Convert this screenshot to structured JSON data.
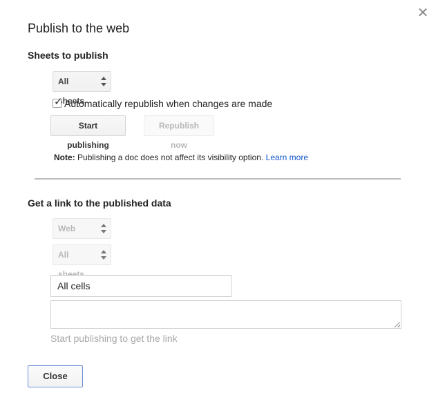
{
  "dialog": {
    "title": "Publish to the web",
    "close_icon": "close-icon"
  },
  "publish_section": {
    "heading": "Sheets to publish",
    "sheets_select": {
      "value": "All sheets"
    },
    "auto_republish": {
      "checked": true,
      "label": "Automatically republish when changes are made"
    },
    "start_button_label": "Start publishing",
    "republish_button_label": "Republish now",
    "note": {
      "prefix": "Note:",
      "text": "Publishing a doc does not affect its visibility option.",
      "link": "Learn more"
    }
  },
  "link_section": {
    "heading": "Get a link to the published data",
    "format_select": {
      "value": "Web page"
    },
    "sheets_select": {
      "value": "All sheets"
    },
    "range_input": {
      "value": "All cells"
    },
    "link_textarea": {
      "value": ""
    },
    "hint": "Start publishing to get the link"
  },
  "footer": {
    "close_label": "Close"
  },
  "colors": {
    "link": "#1155cc",
    "primary_border": "#6a8fd6",
    "disabled_text": "#b8b8b8"
  }
}
